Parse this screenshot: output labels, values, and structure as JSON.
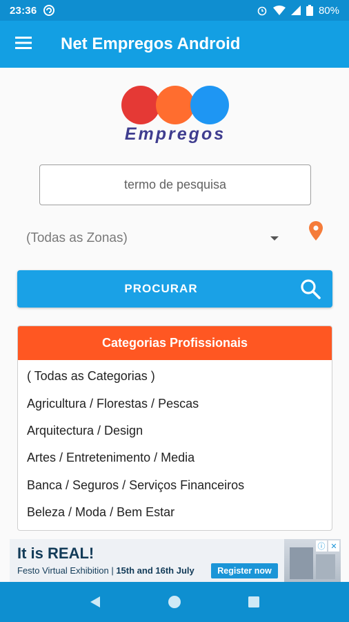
{
  "status_bar": {
    "time": "23:36",
    "battery": "80%"
  },
  "app_bar": {
    "title": "Net Empregos Android",
    "menu_icon": "hamburger-menu-icon"
  },
  "logo": {
    "word": "Empregos",
    "colors": [
      "#e53935",
      "#ff6d2f",
      "#1e96f3"
    ]
  },
  "search": {
    "placeholder": "termo de pesquisa",
    "value": ""
  },
  "zone": {
    "selected": "(Todas as Zonas)",
    "icon": "location-pin-icon"
  },
  "search_button": {
    "label": "PROCURAR",
    "icon": "magnifier-icon"
  },
  "categories": {
    "header": "Categorias Profissionais",
    "items": [
      "( Todas as Categorias )",
      "Agricultura / Florestas / Pescas",
      "Arquitectura / Design",
      "Artes / Entretenimento / Media",
      "Banca / Seguros / Serviços Financeiros",
      "Beleza / Moda / Bem Estar"
    ]
  },
  "ad": {
    "headline": "It is REAL!",
    "sub_prefix": "Festo Virtual Exhibition | ",
    "sub_dates": "15th and 16th July",
    "cta": "Register now"
  },
  "colors": {
    "primary": "#139fe3",
    "status": "#0f8ed0",
    "accent": "#ff5722"
  }
}
